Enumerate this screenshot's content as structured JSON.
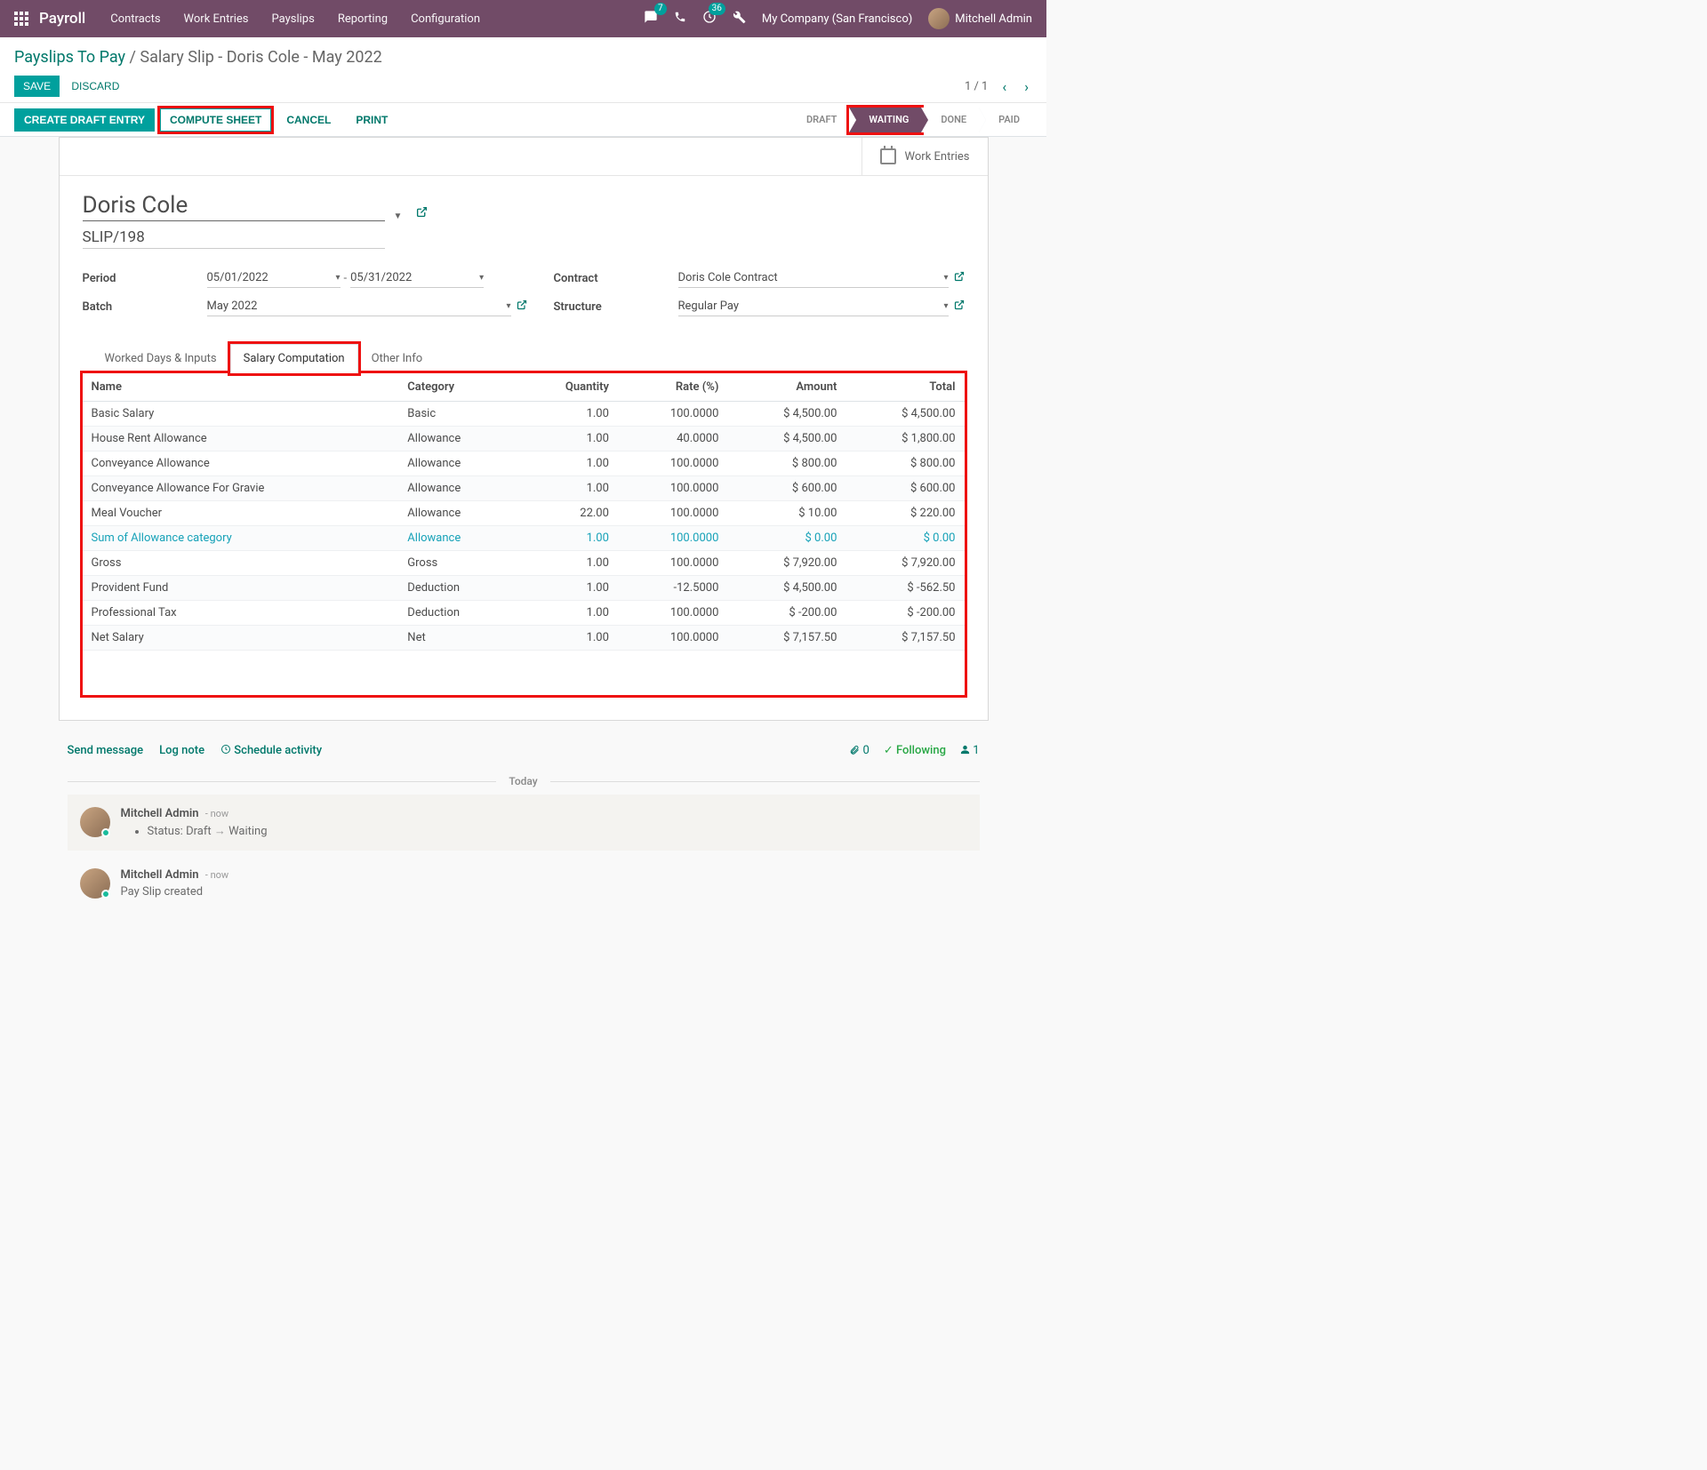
{
  "nav": {
    "app": "Payroll",
    "menu": [
      "Contracts",
      "Work Entries",
      "Payslips",
      "Reporting",
      "Configuration"
    ],
    "msg_badge": "7",
    "act_badge": "36",
    "company": "My Company (San Francisco)",
    "user": "Mitchell Admin"
  },
  "breadcrumb": {
    "link": "Payslips To Pay",
    "current": "Salary Slip - Doris Cole - May 2022"
  },
  "actions": {
    "save": "SAVE",
    "discard": "DISCARD",
    "pager": "1 / 1"
  },
  "statusbar": {
    "buttons": {
      "create_draft": "CREATE DRAFT ENTRY",
      "compute": "COMPUTE SHEET",
      "cancel": "CANCEL",
      "print": "PRINT"
    },
    "steps": [
      "DRAFT",
      "WAITING",
      "DONE",
      "PAID"
    ],
    "active_step": "WAITING"
  },
  "sheet": {
    "work_entries": "Work Entries",
    "employee": "Doris Cole",
    "slip_number": "SLIP/198",
    "labels": {
      "period": "Period",
      "batch": "Batch",
      "contract": "Contract",
      "structure": "Structure"
    },
    "period_from": "05/01/2022",
    "period_to": "05/31/2022",
    "batch": "May 2022",
    "contract": "Doris Cole Contract",
    "structure": "Regular Pay",
    "tabs": {
      "worked": "Worked Days & Inputs",
      "salary": "Salary Computation",
      "other": "Other Info"
    },
    "table": {
      "headers": {
        "name": "Name",
        "category": "Category",
        "quantity": "Quantity",
        "rate": "Rate (%)",
        "amount": "Amount",
        "total": "Total"
      },
      "rows": [
        {
          "name": "Basic Salary",
          "category": "Basic",
          "quantity": "1.00",
          "rate": "100.0000",
          "amount": "$ 4,500.00",
          "total": "$ 4,500.00"
        },
        {
          "name": "House Rent Allowance",
          "category": "Allowance",
          "quantity": "1.00",
          "rate": "40.0000",
          "amount": "$ 4,500.00",
          "total": "$ 1,800.00"
        },
        {
          "name": "Conveyance Allowance",
          "category": "Allowance",
          "quantity": "1.00",
          "rate": "100.0000",
          "amount": "$ 800.00",
          "total": "$ 800.00"
        },
        {
          "name": "Conveyance Allowance For Gravie",
          "category": "Allowance",
          "quantity": "1.00",
          "rate": "100.0000",
          "amount": "$ 600.00",
          "total": "$ 600.00"
        },
        {
          "name": "Meal Voucher",
          "category": "Allowance",
          "quantity": "22.00",
          "rate": "100.0000",
          "amount": "$ 10.00",
          "total": "$ 220.00"
        },
        {
          "name": "Sum of Allowance category",
          "category": "Allowance",
          "quantity": "1.00",
          "rate": "100.0000",
          "amount": "$ 0.00",
          "total": "$ 0.00",
          "link": true
        },
        {
          "name": "Gross",
          "category": "Gross",
          "quantity": "1.00",
          "rate": "100.0000",
          "amount": "$ 7,920.00",
          "total": "$ 7,920.00"
        },
        {
          "name": "Provident Fund",
          "category": "Deduction",
          "quantity": "1.00",
          "rate": "-12.5000",
          "amount": "$ 4,500.00",
          "total": "$ -562.50"
        },
        {
          "name": "Professional Tax",
          "category": "Deduction",
          "quantity": "1.00",
          "rate": "100.0000",
          "amount": "$ -200.00",
          "total": "$ -200.00"
        },
        {
          "name": "Net Salary",
          "category": "Net",
          "quantity": "1.00",
          "rate": "100.0000",
          "amount": "$ 7,157.50",
          "total": "$ 7,157.50"
        }
      ]
    }
  },
  "chatter": {
    "send": "Send message",
    "log": "Log note",
    "schedule": "Schedule activity",
    "attach_count": "0",
    "following": "Following",
    "follower_count": "1",
    "today": "Today",
    "logs": [
      {
        "author": "Mitchell Admin",
        "time": "- now",
        "status_change": {
          "label": "Status:",
          "from": "Draft",
          "to": "Waiting"
        },
        "note": true
      },
      {
        "author": "Mitchell Admin",
        "time": "- now",
        "text": "Pay Slip created",
        "note": false
      }
    ]
  }
}
